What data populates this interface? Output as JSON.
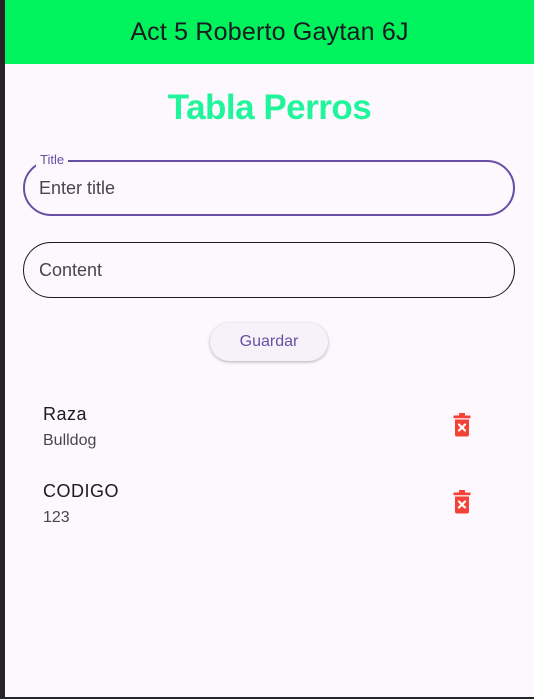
{
  "appbar": {
    "title": "Act 5 Roberto Gaytan 6J",
    "background_color": "#00f25d"
  },
  "page": {
    "heading": "Tabla Perros",
    "heading_color": "#21f59b"
  },
  "form": {
    "title_label": "Title",
    "title_placeholder": "Enter title",
    "content_placeholder": "Content",
    "save_label": "Guardar",
    "accent_color": "#6750a4"
  },
  "items": [
    {
      "title": "Raza",
      "subtitle": "Bulldog",
      "delete_icon": "delete-forever-icon"
    },
    {
      "title": "CODIGO",
      "subtitle": "123",
      "delete_icon": "delete-forever-icon"
    }
  ],
  "colors": {
    "delete_icon": "#f44336",
    "surface": "#fdf7fe"
  }
}
